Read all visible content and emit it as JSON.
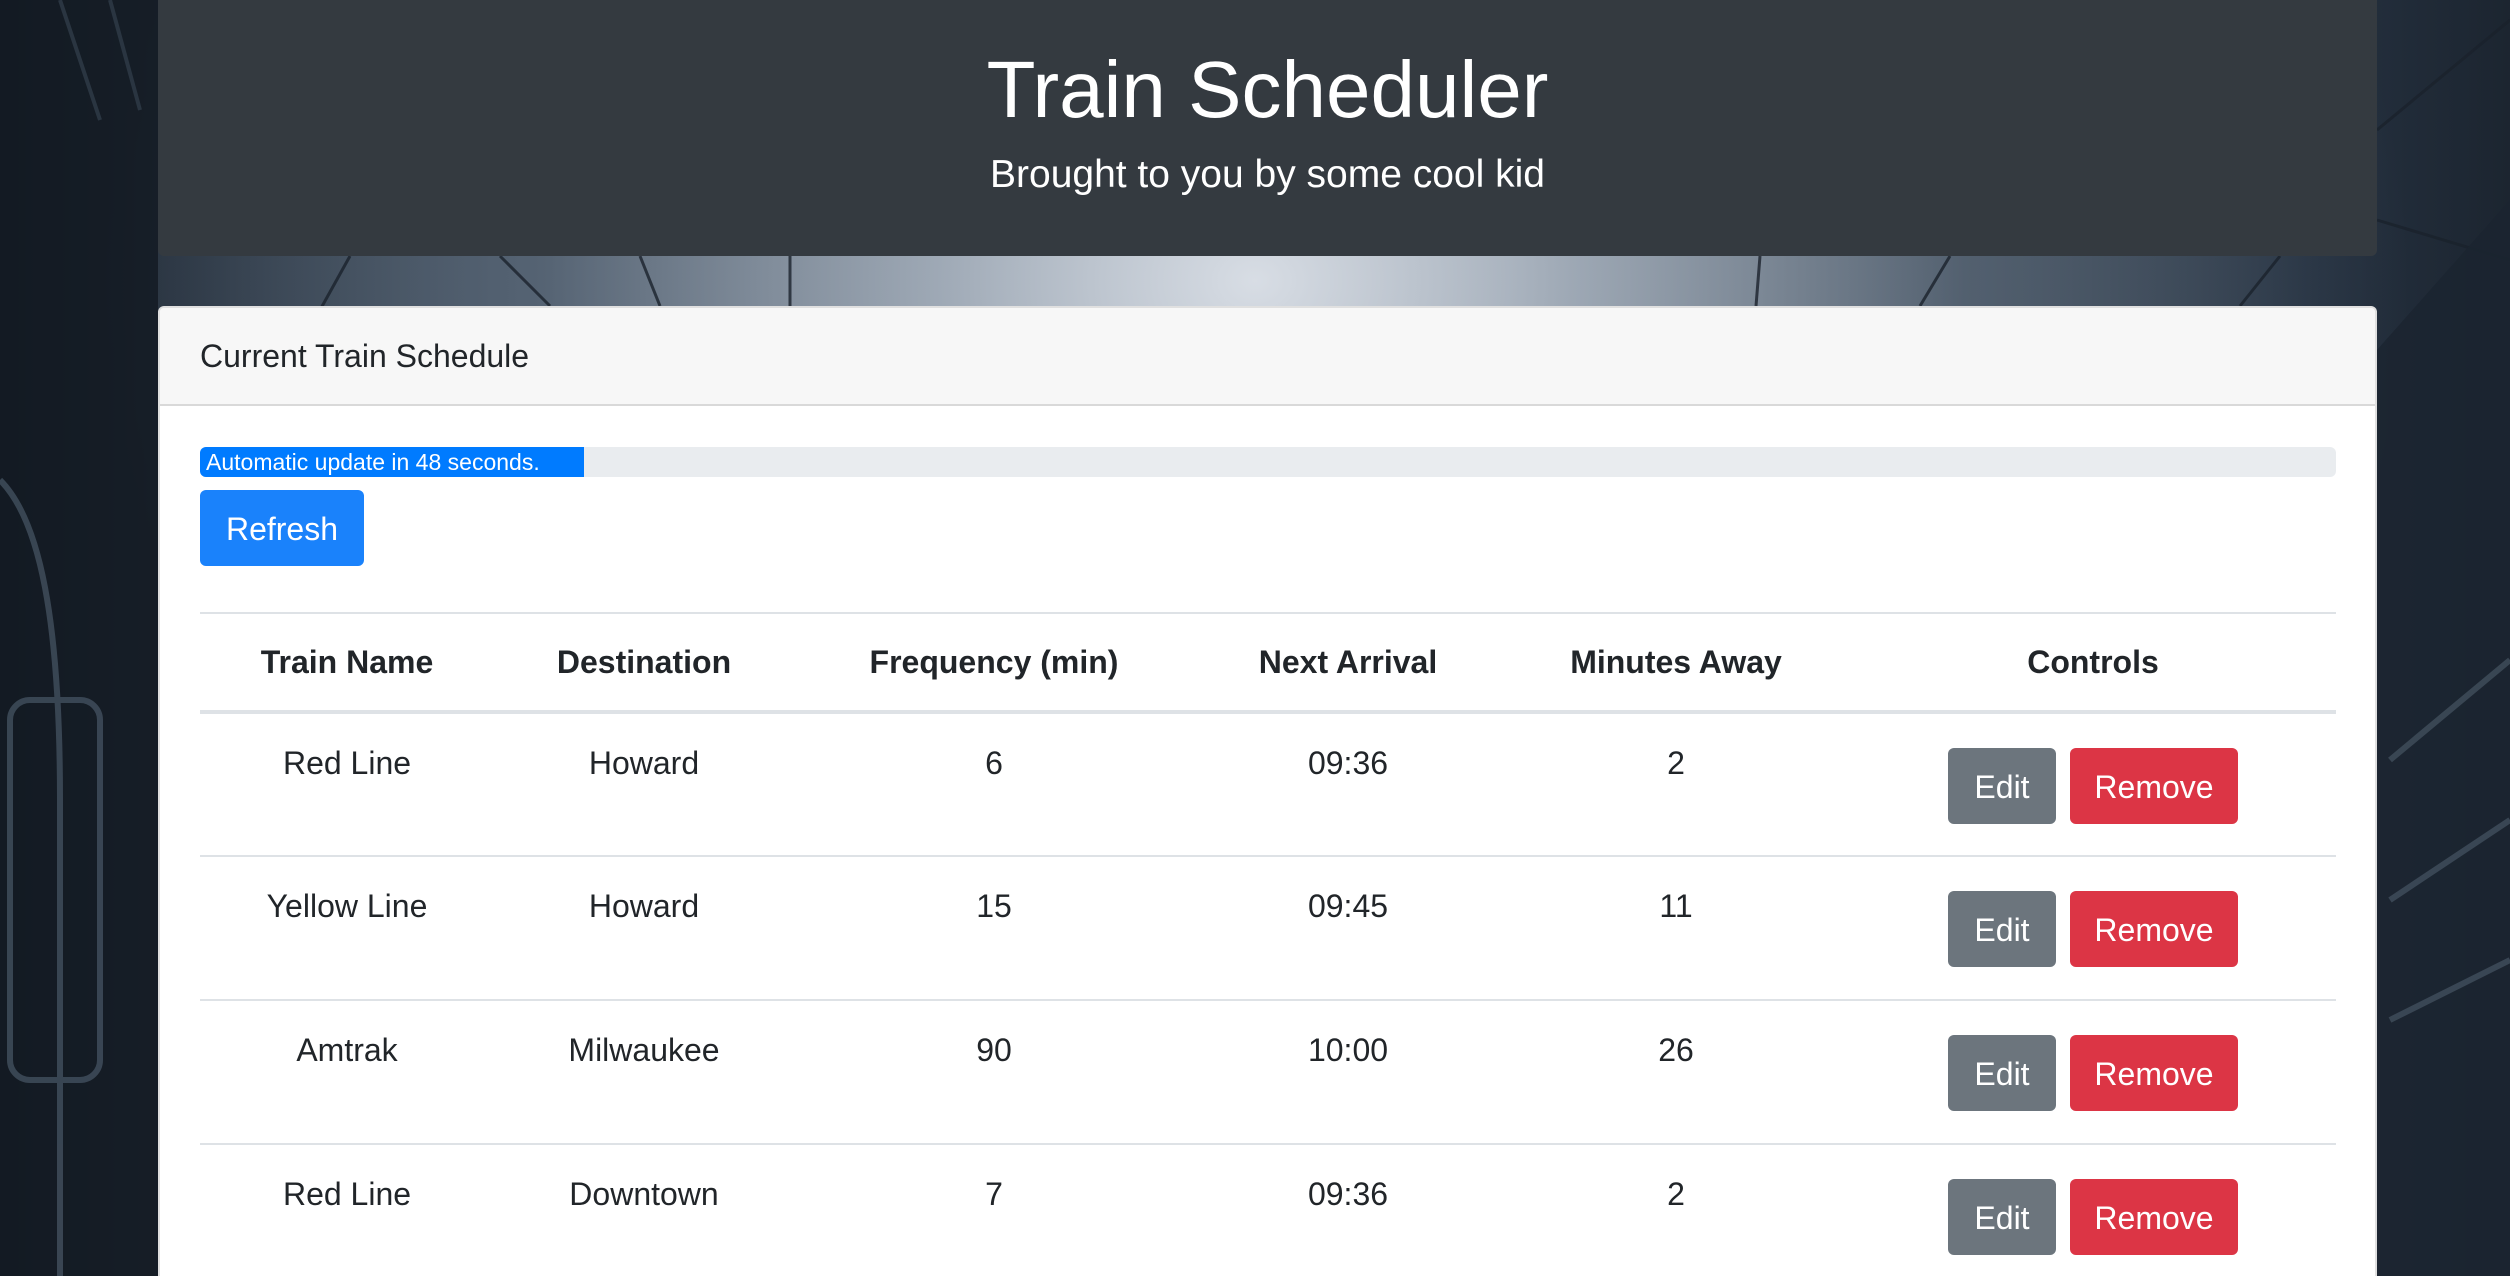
{
  "header": {
    "title": "Train Scheduler",
    "subtitle": "Brought to you by some cool kid"
  },
  "schedule": {
    "card_title": "Current Train Schedule",
    "progress": {
      "label": "Automatic update in 48 seconds.",
      "fraction": 0.18
    },
    "refresh_label": "Refresh",
    "columns": [
      "Train Name",
      "Destination",
      "Frequency (min)",
      "Next Arrival",
      "Minutes Away",
      "Controls"
    ],
    "rows": [
      {
        "name": "Red Line",
        "destination": "Howard",
        "frequency": "6",
        "next_arrival": "09:36",
        "minutes_away": "2"
      },
      {
        "name": "Yellow Line",
        "destination": "Howard",
        "frequency": "15",
        "next_arrival": "09:45",
        "minutes_away": "11"
      },
      {
        "name": "Amtrak",
        "destination": "Milwaukee",
        "frequency": "90",
        "next_arrival": "10:00",
        "minutes_away": "26"
      },
      {
        "name": "Red Line",
        "destination": "Downtown",
        "frequency": "7",
        "next_arrival": "09:36",
        "minutes_away": "2"
      }
    ],
    "edit_label": "Edit",
    "remove_label": "Remove"
  },
  "colors": {
    "jumbotron": "#343a40",
    "primary": "#1a82fb",
    "secondary": "#6c757d",
    "danger": "#dc3545"
  }
}
